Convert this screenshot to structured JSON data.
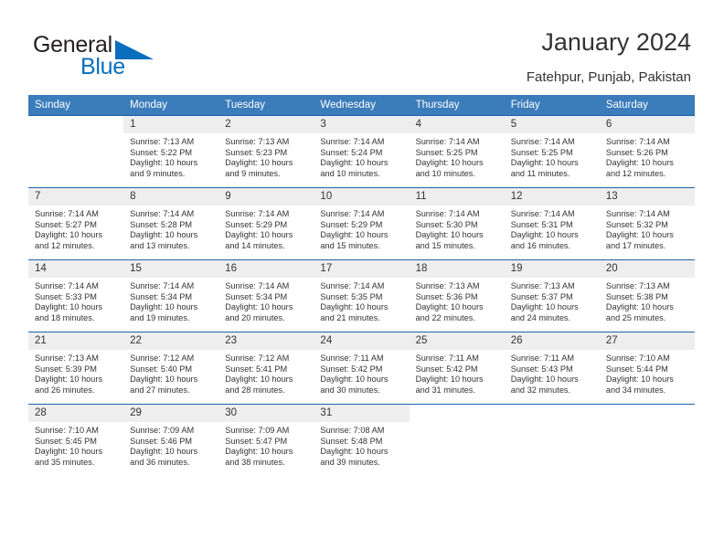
{
  "brand": {
    "name_part1": "General",
    "name_part2": "Blue",
    "accent_color": "#0a6ebd",
    "triangle_icon": "triangle-icon"
  },
  "header": {
    "title": "January 2024",
    "location": "Fatehpur, Punjab, Pakistan"
  },
  "calendar": {
    "header_bg": "#3b7cba",
    "row_divider_color": "#1f63a8",
    "daynum_bg": "#eeeeee",
    "weekdays": [
      "Sunday",
      "Monday",
      "Tuesday",
      "Wednesday",
      "Thursday",
      "Friday",
      "Saturday"
    ],
    "weeks": [
      [
        {
          "day": "",
          "sunrise": "",
          "sunset": "",
          "daylight_line1": "",
          "daylight_line2": ""
        },
        {
          "day": "1",
          "sunrise": "Sunrise: 7:13 AM",
          "sunset": "Sunset: 5:22 PM",
          "daylight_line1": "Daylight: 10 hours",
          "daylight_line2": "and 9 minutes."
        },
        {
          "day": "2",
          "sunrise": "Sunrise: 7:13 AM",
          "sunset": "Sunset: 5:23 PM",
          "daylight_line1": "Daylight: 10 hours",
          "daylight_line2": "and 9 minutes."
        },
        {
          "day": "3",
          "sunrise": "Sunrise: 7:14 AM",
          "sunset": "Sunset: 5:24 PM",
          "daylight_line1": "Daylight: 10 hours",
          "daylight_line2": "and 10 minutes."
        },
        {
          "day": "4",
          "sunrise": "Sunrise: 7:14 AM",
          "sunset": "Sunset: 5:25 PM",
          "daylight_line1": "Daylight: 10 hours",
          "daylight_line2": "and 10 minutes."
        },
        {
          "day": "5",
          "sunrise": "Sunrise: 7:14 AM",
          "sunset": "Sunset: 5:25 PM",
          "daylight_line1": "Daylight: 10 hours",
          "daylight_line2": "and 11 minutes."
        },
        {
          "day": "6",
          "sunrise": "Sunrise: 7:14 AM",
          "sunset": "Sunset: 5:26 PM",
          "daylight_line1": "Daylight: 10 hours",
          "daylight_line2": "and 12 minutes."
        }
      ],
      [
        {
          "day": "7",
          "sunrise": "Sunrise: 7:14 AM",
          "sunset": "Sunset: 5:27 PM",
          "daylight_line1": "Daylight: 10 hours",
          "daylight_line2": "and 12 minutes."
        },
        {
          "day": "8",
          "sunrise": "Sunrise: 7:14 AM",
          "sunset": "Sunset: 5:28 PM",
          "daylight_line1": "Daylight: 10 hours",
          "daylight_line2": "and 13 minutes."
        },
        {
          "day": "9",
          "sunrise": "Sunrise: 7:14 AM",
          "sunset": "Sunset: 5:29 PM",
          "daylight_line1": "Daylight: 10 hours",
          "daylight_line2": "and 14 minutes."
        },
        {
          "day": "10",
          "sunrise": "Sunrise: 7:14 AM",
          "sunset": "Sunset: 5:29 PM",
          "daylight_line1": "Daylight: 10 hours",
          "daylight_line2": "and 15 minutes."
        },
        {
          "day": "11",
          "sunrise": "Sunrise: 7:14 AM",
          "sunset": "Sunset: 5:30 PM",
          "daylight_line1": "Daylight: 10 hours",
          "daylight_line2": "and 15 minutes."
        },
        {
          "day": "12",
          "sunrise": "Sunrise: 7:14 AM",
          "sunset": "Sunset: 5:31 PM",
          "daylight_line1": "Daylight: 10 hours",
          "daylight_line2": "and 16 minutes."
        },
        {
          "day": "13",
          "sunrise": "Sunrise: 7:14 AM",
          "sunset": "Sunset: 5:32 PM",
          "daylight_line1": "Daylight: 10 hours",
          "daylight_line2": "and 17 minutes."
        }
      ],
      [
        {
          "day": "14",
          "sunrise": "Sunrise: 7:14 AM",
          "sunset": "Sunset: 5:33 PM",
          "daylight_line1": "Daylight: 10 hours",
          "daylight_line2": "and 18 minutes."
        },
        {
          "day": "15",
          "sunrise": "Sunrise: 7:14 AM",
          "sunset": "Sunset: 5:34 PM",
          "daylight_line1": "Daylight: 10 hours",
          "daylight_line2": "and 19 minutes."
        },
        {
          "day": "16",
          "sunrise": "Sunrise: 7:14 AM",
          "sunset": "Sunset: 5:34 PM",
          "daylight_line1": "Daylight: 10 hours",
          "daylight_line2": "and 20 minutes."
        },
        {
          "day": "17",
          "sunrise": "Sunrise: 7:14 AM",
          "sunset": "Sunset: 5:35 PM",
          "daylight_line1": "Daylight: 10 hours",
          "daylight_line2": "and 21 minutes."
        },
        {
          "day": "18",
          "sunrise": "Sunrise: 7:13 AM",
          "sunset": "Sunset: 5:36 PM",
          "daylight_line1": "Daylight: 10 hours",
          "daylight_line2": "and 22 minutes."
        },
        {
          "day": "19",
          "sunrise": "Sunrise: 7:13 AM",
          "sunset": "Sunset: 5:37 PM",
          "daylight_line1": "Daylight: 10 hours",
          "daylight_line2": "and 24 minutes."
        },
        {
          "day": "20",
          "sunrise": "Sunrise: 7:13 AM",
          "sunset": "Sunset: 5:38 PM",
          "daylight_line1": "Daylight: 10 hours",
          "daylight_line2": "and 25 minutes."
        }
      ],
      [
        {
          "day": "21",
          "sunrise": "Sunrise: 7:13 AM",
          "sunset": "Sunset: 5:39 PM",
          "daylight_line1": "Daylight: 10 hours",
          "daylight_line2": "and 26 minutes."
        },
        {
          "day": "22",
          "sunrise": "Sunrise: 7:12 AM",
          "sunset": "Sunset: 5:40 PM",
          "daylight_line1": "Daylight: 10 hours",
          "daylight_line2": "and 27 minutes."
        },
        {
          "day": "23",
          "sunrise": "Sunrise: 7:12 AM",
          "sunset": "Sunset: 5:41 PM",
          "daylight_line1": "Daylight: 10 hours",
          "daylight_line2": "and 28 minutes."
        },
        {
          "day": "24",
          "sunrise": "Sunrise: 7:11 AM",
          "sunset": "Sunset: 5:42 PM",
          "daylight_line1": "Daylight: 10 hours",
          "daylight_line2": "and 30 minutes."
        },
        {
          "day": "25",
          "sunrise": "Sunrise: 7:11 AM",
          "sunset": "Sunset: 5:42 PM",
          "daylight_line1": "Daylight: 10 hours",
          "daylight_line2": "and 31 minutes."
        },
        {
          "day": "26",
          "sunrise": "Sunrise: 7:11 AM",
          "sunset": "Sunset: 5:43 PM",
          "daylight_line1": "Daylight: 10 hours",
          "daylight_line2": "and 32 minutes."
        },
        {
          "day": "27",
          "sunrise": "Sunrise: 7:10 AM",
          "sunset": "Sunset: 5:44 PM",
          "daylight_line1": "Daylight: 10 hours",
          "daylight_line2": "and 34 minutes."
        }
      ],
      [
        {
          "day": "28",
          "sunrise": "Sunrise: 7:10 AM",
          "sunset": "Sunset: 5:45 PM",
          "daylight_line1": "Daylight: 10 hours",
          "daylight_line2": "and 35 minutes."
        },
        {
          "day": "29",
          "sunrise": "Sunrise: 7:09 AM",
          "sunset": "Sunset: 5:46 PM",
          "daylight_line1": "Daylight: 10 hours",
          "daylight_line2": "and 36 minutes."
        },
        {
          "day": "30",
          "sunrise": "Sunrise: 7:09 AM",
          "sunset": "Sunset: 5:47 PM",
          "daylight_line1": "Daylight: 10 hours",
          "daylight_line2": "and 38 minutes."
        },
        {
          "day": "31",
          "sunrise": "Sunrise: 7:08 AM",
          "sunset": "Sunset: 5:48 PM",
          "daylight_line1": "Daylight: 10 hours",
          "daylight_line2": "and 39 minutes."
        },
        {
          "day": "",
          "sunrise": "",
          "sunset": "",
          "daylight_line1": "",
          "daylight_line2": ""
        },
        {
          "day": "",
          "sunrise": "",
          "sunset": "",
          "daylight_line1": "",
          "daylight_line2": ""
        },
        {
          "day": "",
          "sunrise": "",
          "sunset": "",
          "daylight_line1": "",
          "daylight_line2": ""
        }
      ]
    ]
  }
}
